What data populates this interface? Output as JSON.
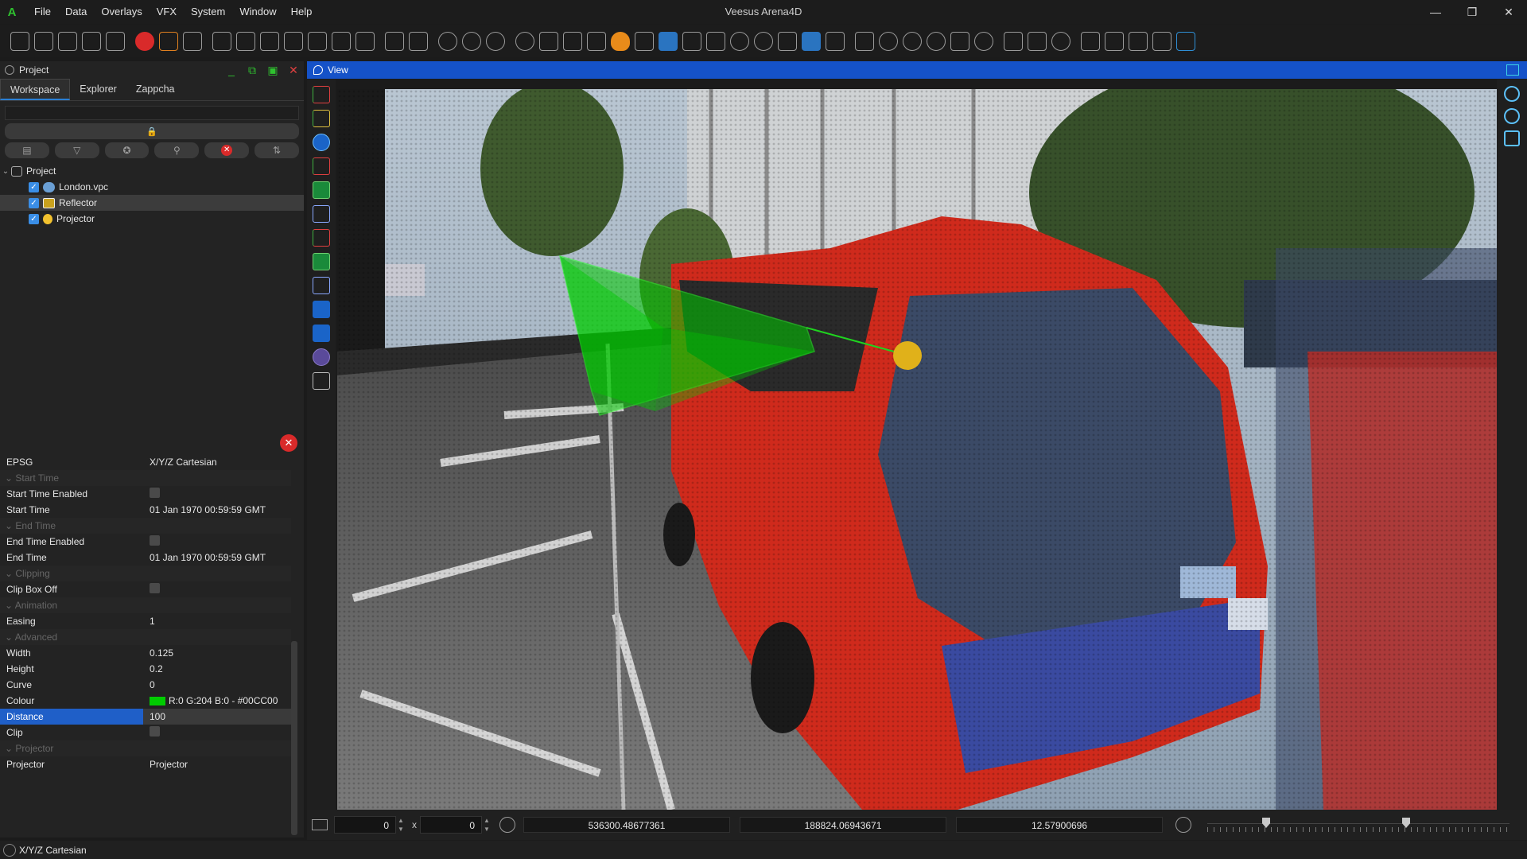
{
  "app": {
    "window_title": "Veesus Arena4D",
    "logo_letter": "A",
    "menu": [
      "File",
      "Data",
      "Overlays",
      "VFX",
      "System",
      "Window",
      "Help"
    ],
    "window_controls": [
      "minimize-icon",
      "restore-icon",
      "close-icon"
    ]
  },
  "toolbar": {
    "icons": [
      "new-icon",
      "open-icon",
      "save-icon",
      "folder-icon",
      "csv-icon",
      "stop-icon",
      "undo-icon",
      "redo-icon",
      "document-icon",
      "print-icon",
      "camera-icon",
      "pdf-icon",
      "layout-icon",
      "render-icon",
      "text-icon",
      "pdf-export-icon",
      "ppt-export-icon",
      "filter-icon",
      "time-icon",
      "target-icon",
      "sphere-icon",
      "image-icon",
      "link-icon",
      "layers-icon",
      "fire-icon",
      "brush-icon",
      "measure-icon",
      "zoom-icon",
      "tools-icon",
      "pin-icon",
      "globe-icon",
      "box-icon",
      "snap-icon",
      "pencil-icon",
      "grid-icon",
      "anchor-icon",
      "cone-icon",
      "compass-icon",
      "house-icon",
      "mountain-icon",
      "up-arrow-icon",
      "up-double-icon",
      "sync-icon",
      "list-icon",
      "ruler-icon",
      "mouse-icon",
      "window-icon",
      "eye-icon"
    ]
  },
  "project_panel": {
    "title": "Project",
    "tabs": [
      "Workspace",
      "Explorer",
      "Zappcha"
    ],
    "active_tab": "Workspace",
    "search_placeholder": "",
    "tree": {
      "root": "Project",
      "children": [
        {
          "label": "London.vpc",
          "checked": true,
          "icon": "pointcloud-icon",
          "selected": false
        },
        {
          "label": "Reflector",
          "checked": true,
          "icon": "reflector-icon",
          "selected": true
        },
        {
          "label": "Projector",
          "checked": true,
          "icon": "projector-icon",
          "selected": false
        }
      ]
    }
  },
  "properties": {
    "rows": [
      {
        "key": "EPSG",
        "value": "X/Y/Z Cartesian"
      },
      {
        "key": "Start Time",
        "group": true
      },
      {
        "key": "Start Time Enabled",
        "checkbox": true
      },
      {
        "key": "Start Time",
        "value": "01 Jan 1970 00:59:59 GMT"
      },
      {
        "key": "End Time",
        "group": true
      },
      {
        "key": "End Time Enabled",
        "checkbox": true
      },
      {
        "key": "End Time",
        "value": "01 Jan 1970 00:59:59 GMT"
      },
      {
        "key": "Clipping",
        "group": true
      },
      {
        "key": "Clip Box Off",
        "checkbox": true
      },
      {
        "key": "Animation",
        "group": true
      },
      {
        "key": "Easing",
        "value": "1"
      },
      {
        "key": "Advanced",
        "group": true
      },
      {
        "key": "Width",
        "value": "0.125"
      },
      {
        "key": "Height",
        "value": "0.2"
      },
      {
        "key": "Curve",
        "value": "0"
      },
      {
        "key": "Colour",
        "value": "R:0 G:204 B:0 - #00CC00",
        "swatch": "#00cc00"
      },
      {
        "key": "Distance",
        "value": "100",
        "highlight": true
      },
      {
        "key": "Clip",
        "checkbox": true
      },
      {
        "key": "Projector",
        "group": true
      },
      {
        "key": "Projector",
        "value": "Projector"
      }
    ]
  },
  "status_bar": {
    "crs": "X/Y/Z Cartesian"
  },
  "view": {
    "title": "View",
    "spin_x": "0",
    "spin_y": "0",
    "x_separator": "x",
    "coord_x": "536300.48677361",
    "coord_y": "188824.06943671",
    "coord_z": "12.57900696",
    "timeline_thumbs": [
      0.21,
      0.65
    ]
  },
  "colors": {
    "accent": "#1552c8",
    "reflector": "#00cc00",
    "bus": "#d42a1c",
    "danger": "#d92a2a"
  }
}
